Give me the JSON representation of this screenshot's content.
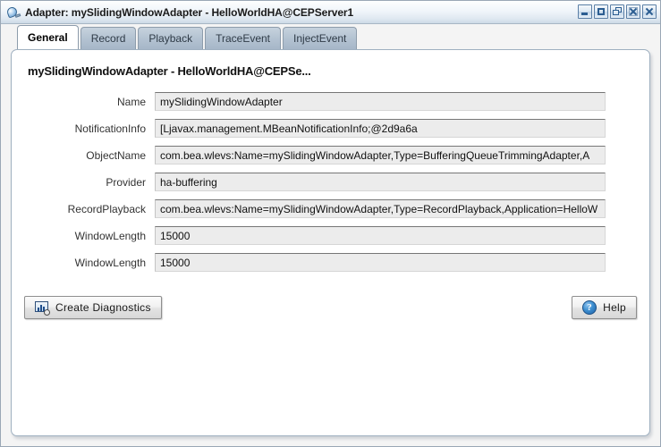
{
  "window": {
    "title": "Adapter: mySlidingWindowAdapter - HelloWorldHA@CEPServer1",
    "icon": "adapter-icon",
    "controls": [
      {
        "name": "minimize-button",
        "glyph": "minimize-icon"
      },
      {
        "name": "maximize-button",
        "glyph": "maximize-icon"
      },
      {
        "name": "restore-button",
        "glyph": "restore-icon"
      },
      {
        "name": "close-inner-button",
        "glyph": "close-icon"
      },
      {
        "name": "close-button",
        "glyph": "close-icon"
      }
    ]
  },
  "tabs": [
    {
      "label": "General",
      "active": true
    },
    {
      "label": "Record",
      "active": false
    },
    {
      "label": "Playback",
      "active": false
    },
    {
      "label": "TraceEvent",
      "active": false
    },
    {
      "label": "InjectEvent",
      "active": false
    }
  ],
  "panel": {
    "heading": "mySlidingWindowAdapter - HelloWorldHA@CEPSe...",
    "fields": [
      {
        "label": "Name",
        "value": "mySlidingWindowAdapter"
      },
      {
        "label": "NotificationInfo",
        "value": "[Ljavax.management.MBeanNotificationInfo;@2d9a6a"
      },
      {
        "label": "ObjectName",
        "value": "com.bea.wlevs:Name=mySlidingWindowAdapter,Type=BufferingQueueTrimmingAdapter,A"
      },
      {
        "label": "Provider",
        "value": "ha-buffering"
      },
      {
        "label": "RecordPlayback",
        "value": "com.bea.wlevs:Name=mySlidingWindowAdapter,Type=RecordPlayback,Application=HelloW"
      },
      {
        "label": "WindowLength",
        "value": "15000"
      },
      {
        "label": "WindowLength",
        "value": "15000"
      }
    ]
  },
  "buttons": {
    "create_diagnostics": {
      "label": "Create Diagnostics",
      "icon": "diagnostics-chart-icon"
    },
    "help": {
      "label": "Help",
      "icon": "help-question-icon"
    }
  },
  "colors": {
    "titlebar_accent": "#ccd9e6",
    "tab_inactive": "#b4c3d2",
    "field_background": "#ececec",
    "panel_border": "#9fb0c0",
    "icon_blue": "#1f62a8"
  }
}
